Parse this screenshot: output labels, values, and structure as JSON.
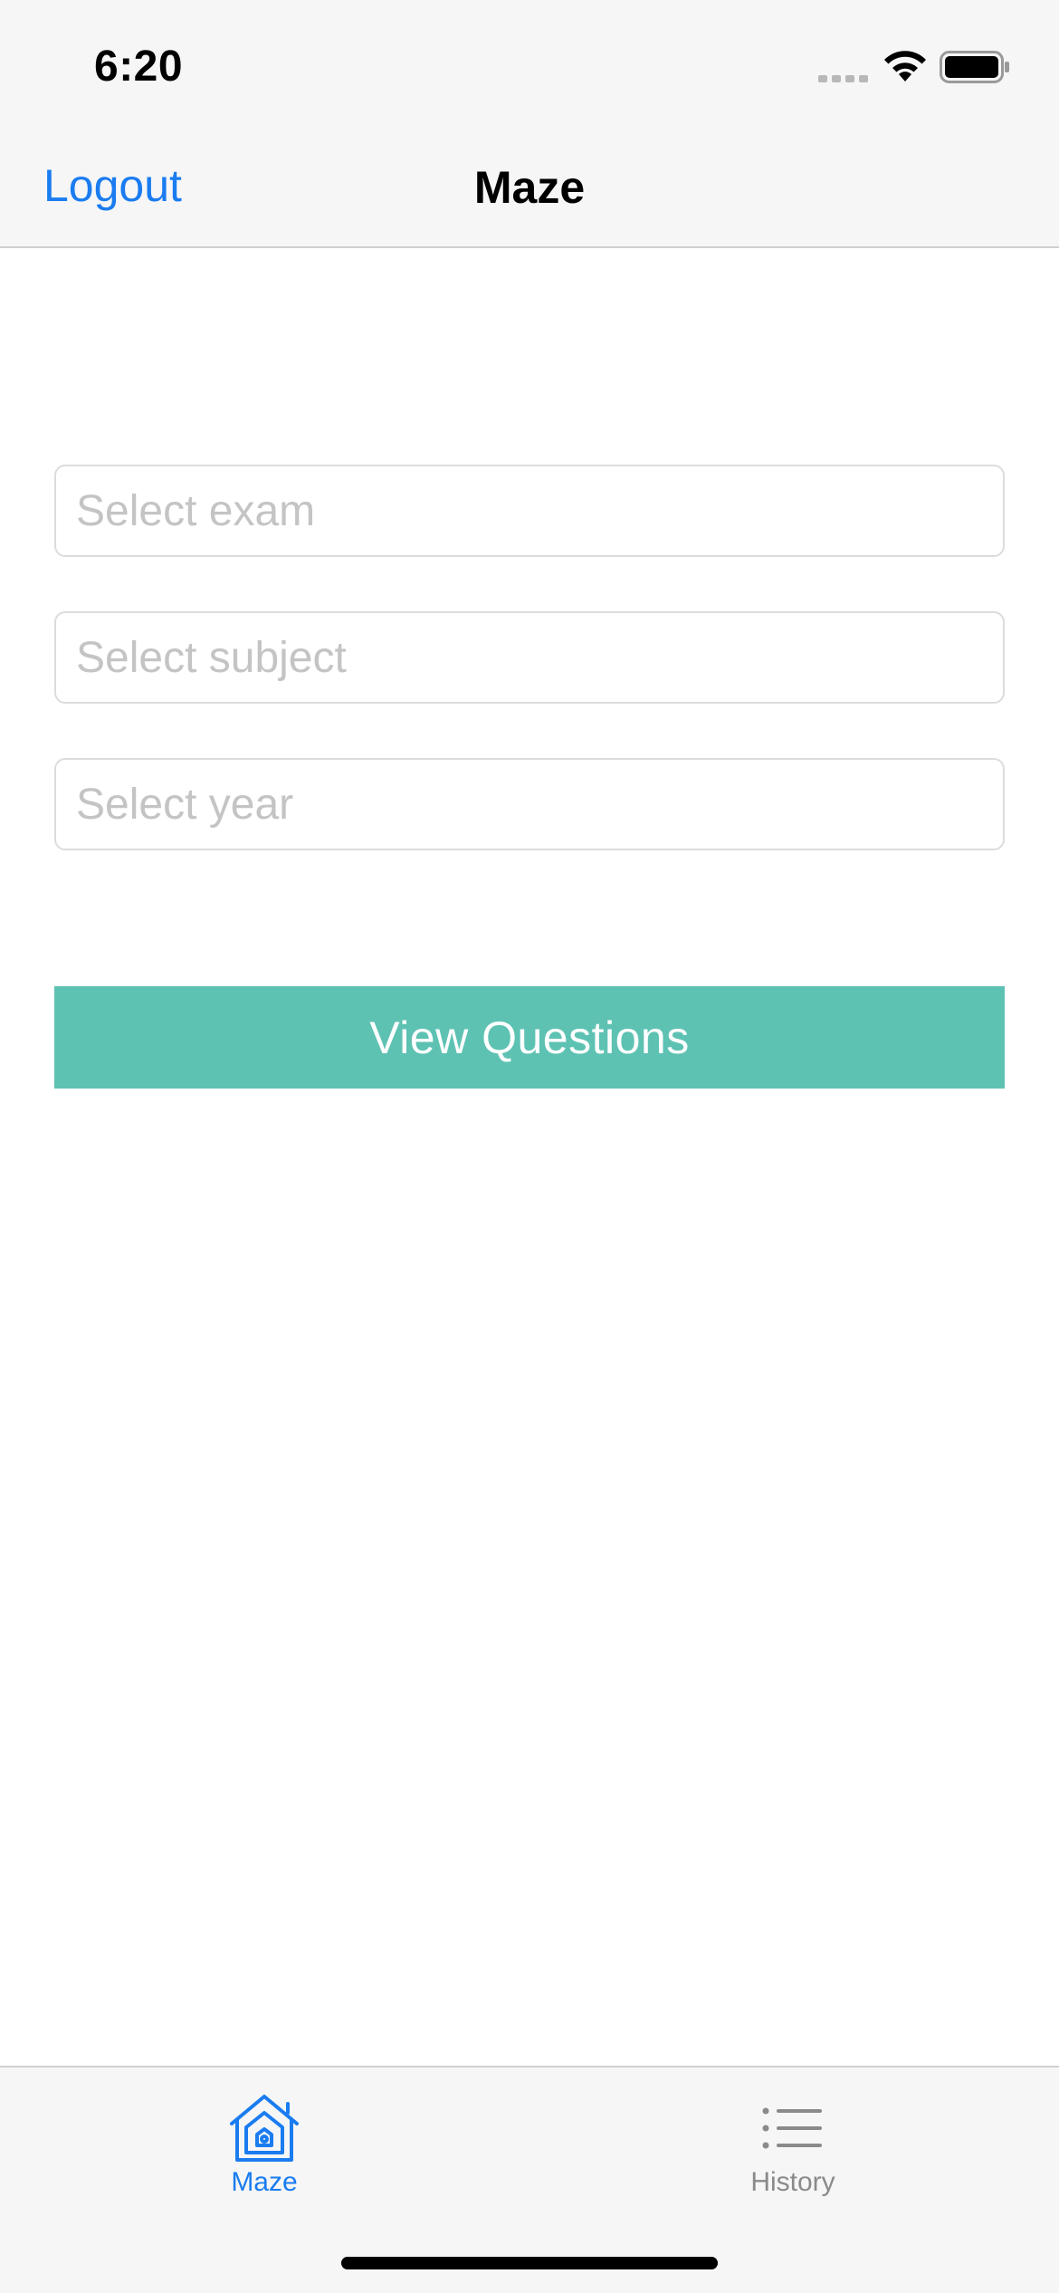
{
  "status_bar": {
    "time": "6:20",
    "icons": [
      "cellular-signal-icon",
      "wifi-icon",
      "battery-icon"
    ]
  },
  "nav": {
    "left_button": "Logout",
    "title": "Maze"
  },
  "form": {
    "exam_placeholder": "Select exam",
    "subject_placeholder": "Select subject",
    "year_placeholder": "Select year",
    "submit_label": "View Questions"
  },
  "tabs": [
    {
      "label": "Maze",
      "icon": "home-icon",
      "active": true
    },
    {
      "label": "History",
      "icon": "list-icon",
      "active": false
    }
  ],
  "colors": {
    "accent": "#1a7cf0",
    "button": "#5ec2b3",
    "bar_background": "#f6f6f6",
    "placeholder": "#c4c4c4",
    "inactive_tab": "#8a8a8a"
  }
}
